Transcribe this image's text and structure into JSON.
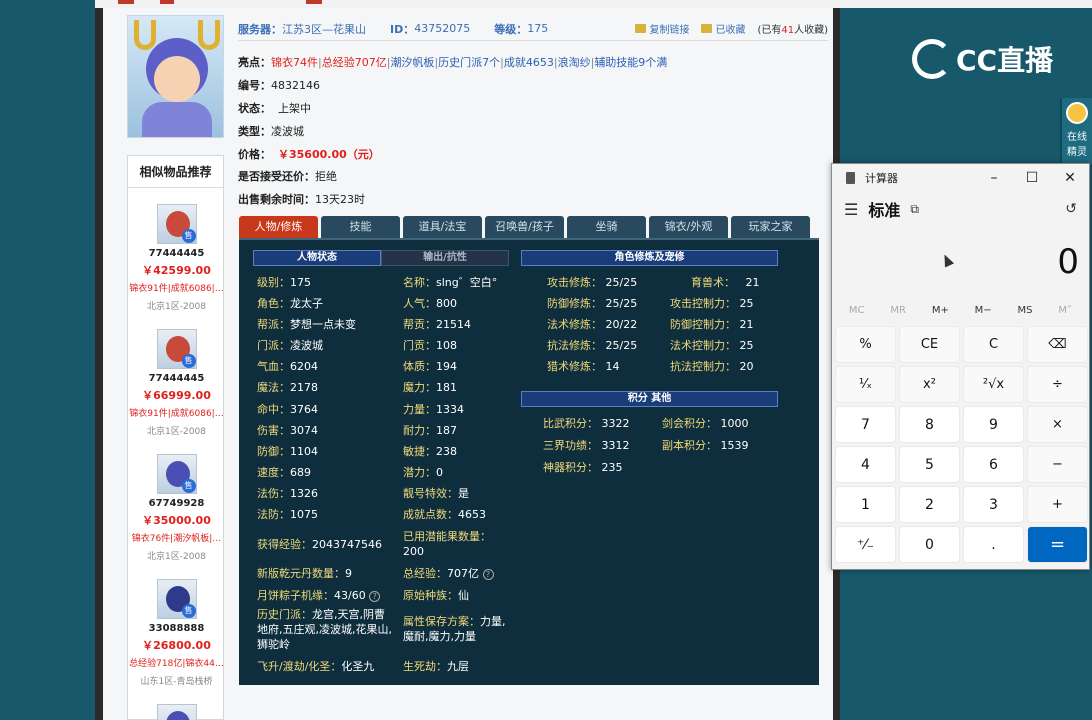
{
  "header": {
    "server_label": "服务器：",
    "server": "江苏3区—花果山",
    "id_label": "ID：",
    "id": "43752075",
    "level_label": "等级：",
    "level": "175",
    "copy_link": "复制链接",
    "favorited": "已收藏",
    "fav_count_prefix": "(已有",
    "fav_count": "41",
    "fav_count_suffix": "人收藏)"
  },
  "highlights": {
    "label": "亮点：",
    "items": [
      "锦衣74件",
      "总经验707亿",
      "潮汐帆板",
      "历史门派7个",
      "成就4653",
      "浪淘纱",
      "辅助技能9个满"
    ]
  },
  "details": {
    "number_label": "编号：",
    "number": "4832146",
    "status_label": "状态：",
    "status": "上架中",
    "type_label": "类型：",
    "type": "凌波城",
    "price_label": "价格：",
    "price": "￥35600.00（元）",
    "counter_label": "是否接受还价：",
    "counter": "拒绝",
    "remain_label": "出售剩余时间：",
    "remain": "13天23时"
  },
  "similar": {
    "title": "相似物品推荐",
    "items": [
      {
        "id": "77444445",
        "price": "￥42599.00",
        "hl": "锦衣91件|成就6086|…",
        "srv": "北京1区-2008"
      },
      {
        "id": "77444445",
        "price": "￥66999.00",
        "hl": "锦衣91件|成就6086|…",
        "srv": "北京1区-2008"
      },
      {
        "id": "67749928",
        "price": "￥35000.00",
        "hl": "锦衣76件|潮汐帆板|…",
        "srv": "北京1区-2008"
      },
      {
        "id": "33088888",
        "price": "￥26800.00",
        "hl": "总经验718亿|锦衣44…",
        "srv": "山东1区-青岛栈桥"
      }
    ],
    "sale_tag": "售"
  },
  "tabs": [
    "人物/修炼",
    "技能",
    "道具/法宝",
    "召唤兽/孩子",
    "坐骑",
    "锦衣/外观",
    "玩家之家"
  ],
  "panel": {
    "h_status": "人物状态",
    "h_output": "输出/抗性",
    "h_cultivation": "角色修炼及宠修",
    "h_score": "积分 其他",
    "left": [
      {
        "k": "级别：",
        "v": "175"
      },
      {
        "k": "角色：",
        "v": "龙太子"
      },
      {
        "k": "帮派：",
        "v": "梦想一点未变"
      },
      {
        "k": "门派：",
        "v": "凌波城"
      },
      {
        "k": "气血：",
        "v": "6204"
      },
      {
        "k": "魔法：",
        "v": "2178"
      },
      {
        "k": "命中：",
        "v": "3764"
      },
      {
        "k": "伤害：",
        "v": "3074"
      },
      {
        "k": "防御：",
        "v": "1104"
      },
      {
        "k": "速度：",
        "v": "689"
      },
      {
        "k": "法伤：",
        "v": "1326"
      },
      {
        "k": "法防：",
        "v": "1075"
      }
    ],
    "mid": [
      {
        "k": "名称：",
        "v": "slng゛空白°"
      },
      {
        "k": "人气：",
        "v": "800"
      },
      {
        "k": "帮贡：",
        "v": "21514"
      },
      {
        "k": "门贡：",
        "v": "108"
      },
      {
        "k": "体质：",
        "v": "194"
      },
      {
        "k": "魔力：",
        "v": "181"
      },
      {
        "k": "力量：",
        "v": "1334"
      },
      {
        "k": "耐力：",
        "v": "187"
      },
      {
        "k": "敏捷：",
        "v": "238"
      },
      {
        "k": "潜力：",
        "v": "0"
      },
      {
        "k": "靓号特效：",
        "v": "是"
      },
      {
        "k": "成就点数：",
        "v": "4653"
      }
    ],
    "exp_k": "获得经验：",
    "exp_v": "2043747546",
    "potential_fruit_k": "已用潜能果数量：",
    "potential_fruit_v": "200",
    "qianyuan_k": "新版乾元丹数量：",
    "qianyuan_v": "9",
    "total_exp_k": "总经验：",
    "total_exp_v": "707亿",
    "zongzi_k": "月饼粽子机缘：",
    "zongzi_v": "43/60",
    "race_k": "原始种族：",
    "race_v": "仙",
    "history_k": "历史门派：",
    "history_v": "龙宫,天宫,阴曹地府,五庄观,凌波城,花果山,狮驼岭",
    "attr_plan_k": "属性保存方案：",
    "attr_plan_v": "力量,魔耐,魔力,力量",
    "ascend_k": "飞升/渡劫/化圣：",
    "ascend_v": "化圣九",
    "lifedeath_k": "生死劫：",
    "lifedeath_v": "九层",
    "cult": [
      {
        "k": "攻击修炼：",
        "v": "25/25",
        "k2": "育兽术：",
        "v2": "21"
      },
      {
        "k": "防御修炼：",
        "v": "25/25",
        "k2": "攻击控制力：",
        "v2": "25"
      },
      {
        "k": "法术修炼：",
        "v": "20/22",
        "k2": "防御控制力：",
        "v2": "21"
      },
      {
        "k": "抗法修炼：",
        "v": "25/25",
        "k2": "法术控制力：",
        "v2": "25"
      },
      {
        "k": "猎术修炼：",
        "v": "14",
        "k2": "抗法控制力：",
        "v2": "20"
      }
    ],
    "score": [
      {
        "k": "比武积分：",
        "v": "3322",
        "k2": "剑会积分：",
        "v2": "1000"
      },
      {
        "k": "三界功绩：",
        "v": "3312",
        "k2": "副本积分：",
        "v2": "1539"
      },
      {
        "k": "神器积分：",
        "v": "235"
      }
    ]
  },
  "cc": {
    "logo": "CC直播",
    "side_line1": "在线",
    "side_line2": "精灵"
  },
  "calculator": {
    "title": "计算器",
    "mode": "标准",
    "display": "0",
    "memory": [
      "MC",
      "MR",
      "M+",
      "M−",
      "MS",
      "M˅"
    ],
    "keys": [
      "%",
      "CE",
      "C",
      "⌫",
      "¹⁄ₓ",
      "x²",
      "²√x",
      "÷",
      "7",
      "8",
      "9",
      "×",
      "4",
      "5",
      "6",
      "−",
      "1",
      "2",
      "3",
      "+",
      "⁺⁄₋",
      "0",
      ".",
      "="
    ]
  }
}
